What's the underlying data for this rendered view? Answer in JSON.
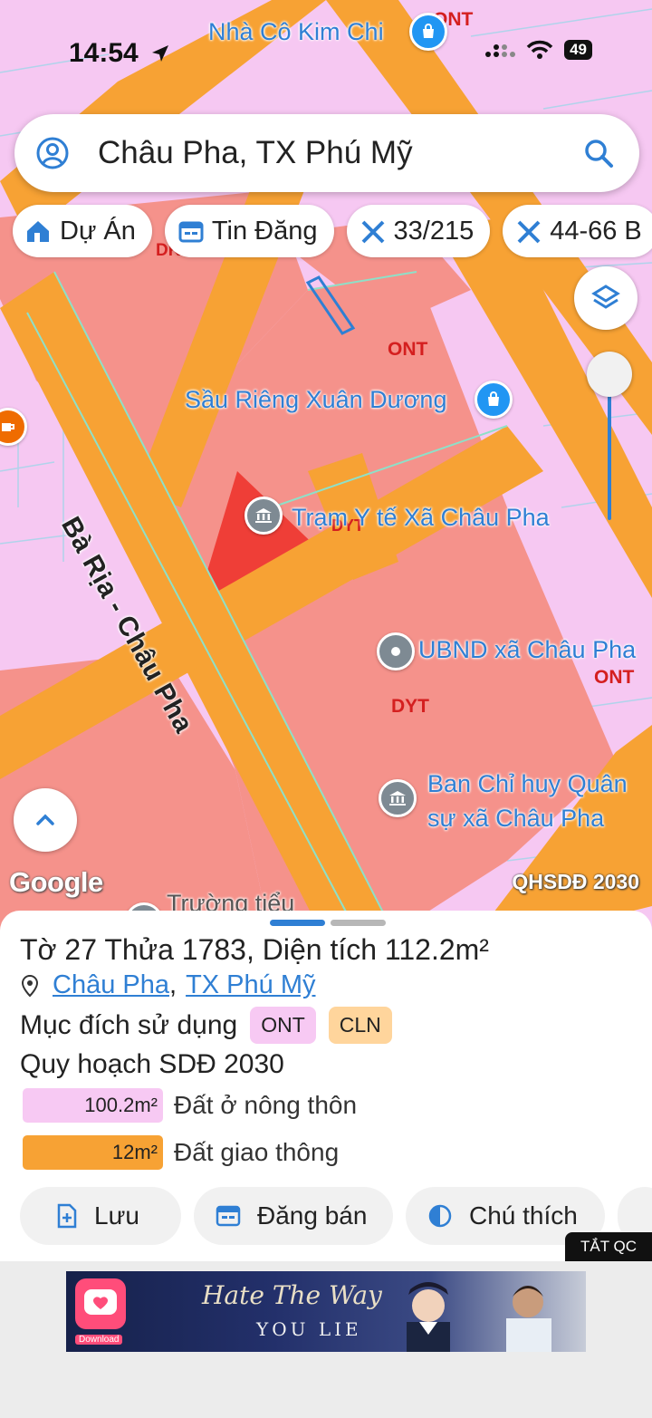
{
  "status": {
    "time": "14:54",
    "battery": "49"
  },
  "search": {
    "text": "Châu Pha, TX Phú Mỹ"
  },
  "chips": [
    {
      "label": "Dự Án",
      "icon": "house-icon"
    },
    {
      "label": "Tin Đăng",
      "icon": "calendar-icon"
    },
    {
      "label": "33/215",
      "icon": "ruler-icon"
    },
    {
      "label": "44-66 B",
      "icon": "ruler-icon"
    }
  ],
  "map": {
    "labels": {
      "nha_co": "Nhà Cô Kim Chi",
      "sau_rieng": "Sầu Riêng Xuân Dương",
      "tram_yte": "Trạm Y tế Xã Châu Pha",
      "ubnd": "UBND xã Châu Pha",
      "ban_chi_huy_1": "Ban Chỉ huy Quân",
      "ban_chi_huy_2": "sự xã Châu Pha",
      "truong": "Trường tiểu",
      "road": "Bà Rịa - Châu Pha"
    },
    "zones": {
      "ont_top": "ONT",
      "ont_mid": "ONT",
      "ont_right": "ONT",
      "dyt": "DYT",
      "dyt_small": "DYT",
      "dkv": "DKV"
    },
    "google": "Google",
    "plan_badge": "QHSDĐ 2030"
  },
  "parcel": {
    "title_pre": "Tờ ",
    "sheet_no": "27",
    "title_mid": " Thửa ",
    "parcel_no": "1783",
    "title_area_label": ", Diện tích ",
    "area": "112.2m²",
    "commune": "Châu Pha",
    "separator": ",",
    "town": "TX Phú Mỹ",
    "usage_label": "Mục đích sử dụng",
    "usage_tags": [
      "ONT",
      "CLN"
    ],
    "plan_label": "Quy hoạch SDĐ 2030",
    "areas": [
      {
        "value": "100.2m²",
        "label": "Đất ở nông thôn",
        "color": "#f7c9f3"
      },
      {
        "value": "12m²",
        "label": "Đất giao thông",
        "color": "#f7a234"
      }
    ]
  },
  "actions": {
    "save": "Lưu",
    "sell": "Đăng bán",
    "legend": "Chú thích"
  },
  "ads": {
    "close": "TẮT QC",
    "cursive": "Hate The Way",
    "you_lie": "YOU LIE",
    "download": "Download"
  },
  "colors": {
    "residential": "#f6c8f2",
    "road": "#f7a234",
    "health": "#f5928b",
    "selected_parcel": "#ef3e37",
    "accent": "#2f7fd4"
  }
}
